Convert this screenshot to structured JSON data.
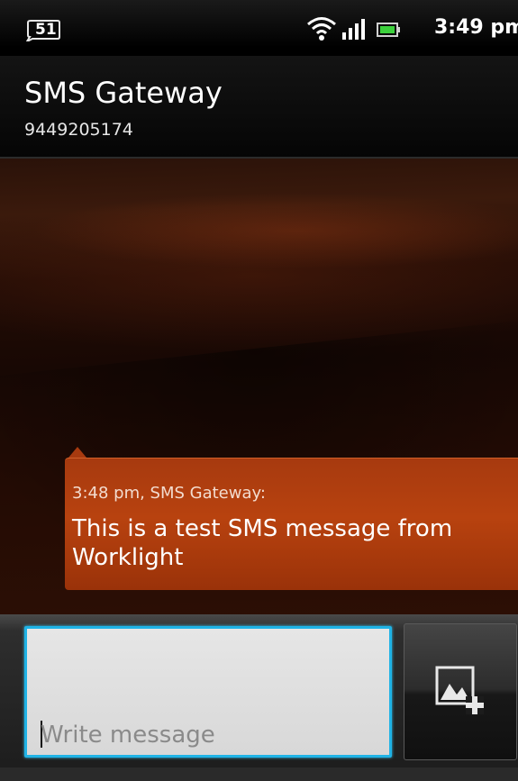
{
  "status_bar": {
    "notification_count": "51",
    "time": "3:49 pm",
    "icons": [
      "wifi-icon",
      "signal-icon",
      "battery-icon"
    ],
    "battery_color": "#3cd13c"
  },
  "title_bar": {
    "contact_name": "SMS Gateway",
    "contact_number": "9449205174"
  },
  "messages": [
    {
      "meta": "3:48 pm, SMS Gateway:",
      "text": "This is a test SMS message from Worklight"
    }
  ],
  "compose": {
    "placeholder": "Write message",
    "attach_icon": "attach-image-icon",
    "focus_color": "#1fb3e6"
  },
  "colors": {
    "bubble": "#b8420f",
    "background": "#000000"
  }
}
